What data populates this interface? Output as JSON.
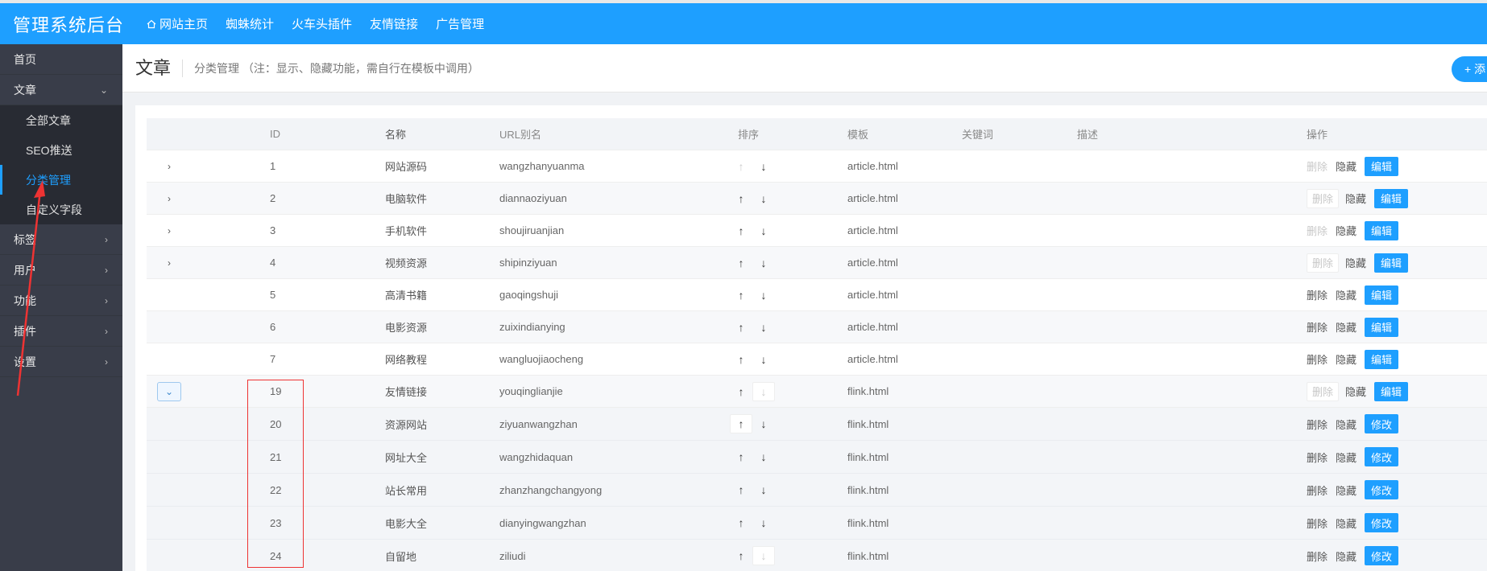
{
  "brand": "管理系统后台",
  "topnav": [
    {
      "label": "网站主页",
      "icon": "home-icon"
    },
    {
      "label": "蜘蛛统计"
    },
    {
      "label": "火车头插件"
    },
    {
      "label": "友情链接"
    },
    {
      "label": "广告管理"
    }
  ],
  "sidebar": {
    "items": [
      {
        "label": "首页"
      },
      {
        "label": "文章",
        "expanded": true,
        "children": [
          "全部文章",
          "SEO推送",
          "分类管理",
          "自定义字段"
        ],
        "active_child": "分类管理"
      },
      {
        "label": "标签"
      },
      {
        "label": "用户"
      },
      {
        "label": "功能"
      },
      {
        "label": "插件"
      },
      {
        "label": "设置"
      }
    ]
  },
  "page": {
    "title": "文章",
    "desc": "分类管理 （注：显示、隐藏功能，需自行在模板中调用）",
    "add_label": "+ 添"
  },
  "table": {
    "headers": [
      "ID",
      "名称",
      "URL别名",
      "排序",
      "模板",
      "关键词",
      "描述",
      "操作"
    ],
    "ops": {
      "delete": "删除",
      "hide": "隐藏",
      "edit": "编辑",
      "modify": "修改"
    },
    "rows": [
      {
        "id": "1",
        "name": "网站源码",
        "url": "wangzhanyuanma",
        "tpl": "article.html",
        "expander": "collapsed"
      },
      {
        "id": "2",
        "name": "电脑软件",
        "url": "diannaoziyuan",
        "tpl": "article.html",
        "expander": "collapsed"
      },
      {
        "id": "3",
        "name": "手机软件",
        "url": "shoujiruanjian",
        "tpl": "article.html",
        "expander": "collapsed"
      },
      {
        "id": "4",
        "name": "视频资源",
        "url": "shipinziyuan",
        "tpl": "article.html",
        "expander": "collapsed"
      },
      {
        "id": "5",
        "name": "高清书籍",
        "url": "gaoqingshuji",
        "tpl": "article.html"
      },
      {
        "id": "6",
        "name": "电影资源",
        "url": "zuixindianying",
        "tpl": "article.html"
      },
      {
        "id": "7",
        "name": "网络教程",
        "url": "wangluojiaocheng",
        "tpl": "article.html"
      },
      {
        "id": "19",
        "name": "友情链接",
        "url": "youqinglianjie",
        "tpl": "flink.html",
        "expander": "expanded"
      },
      {
        "id": "20",
        "name": "资源网站",
        "url": "ziyuanwangzhan",
        "tpl": "flink.html",
        "child": true
      },
      {
        "id": "21",
        "name": "网址大全",
        "url": "wangzhidaquan",
        "tpl": "flink.html",
        "child": true
      },
      {
        "id": "22",
        "name": "站长常用",
        "url": "zhanzhangchangyong",
        "tpl": "flink.html",
        "child": true
      },
      {
        "id": "23",
        "name": "电影大全",
        "url": "dianyingwangzhan",
        "tpl": "flink.html",
        "child": true
      },
      {
        "id": "24",
        "name": "自留地",
        "url": "ziliudi",
        "tpl": "flink.html",
        "child": true
      }
    ]
  },
  "colors": {
    "accent": "#1e9fff",
    "sidebar": "#393d49",
    "annotation": "#e33333"
  }
}
